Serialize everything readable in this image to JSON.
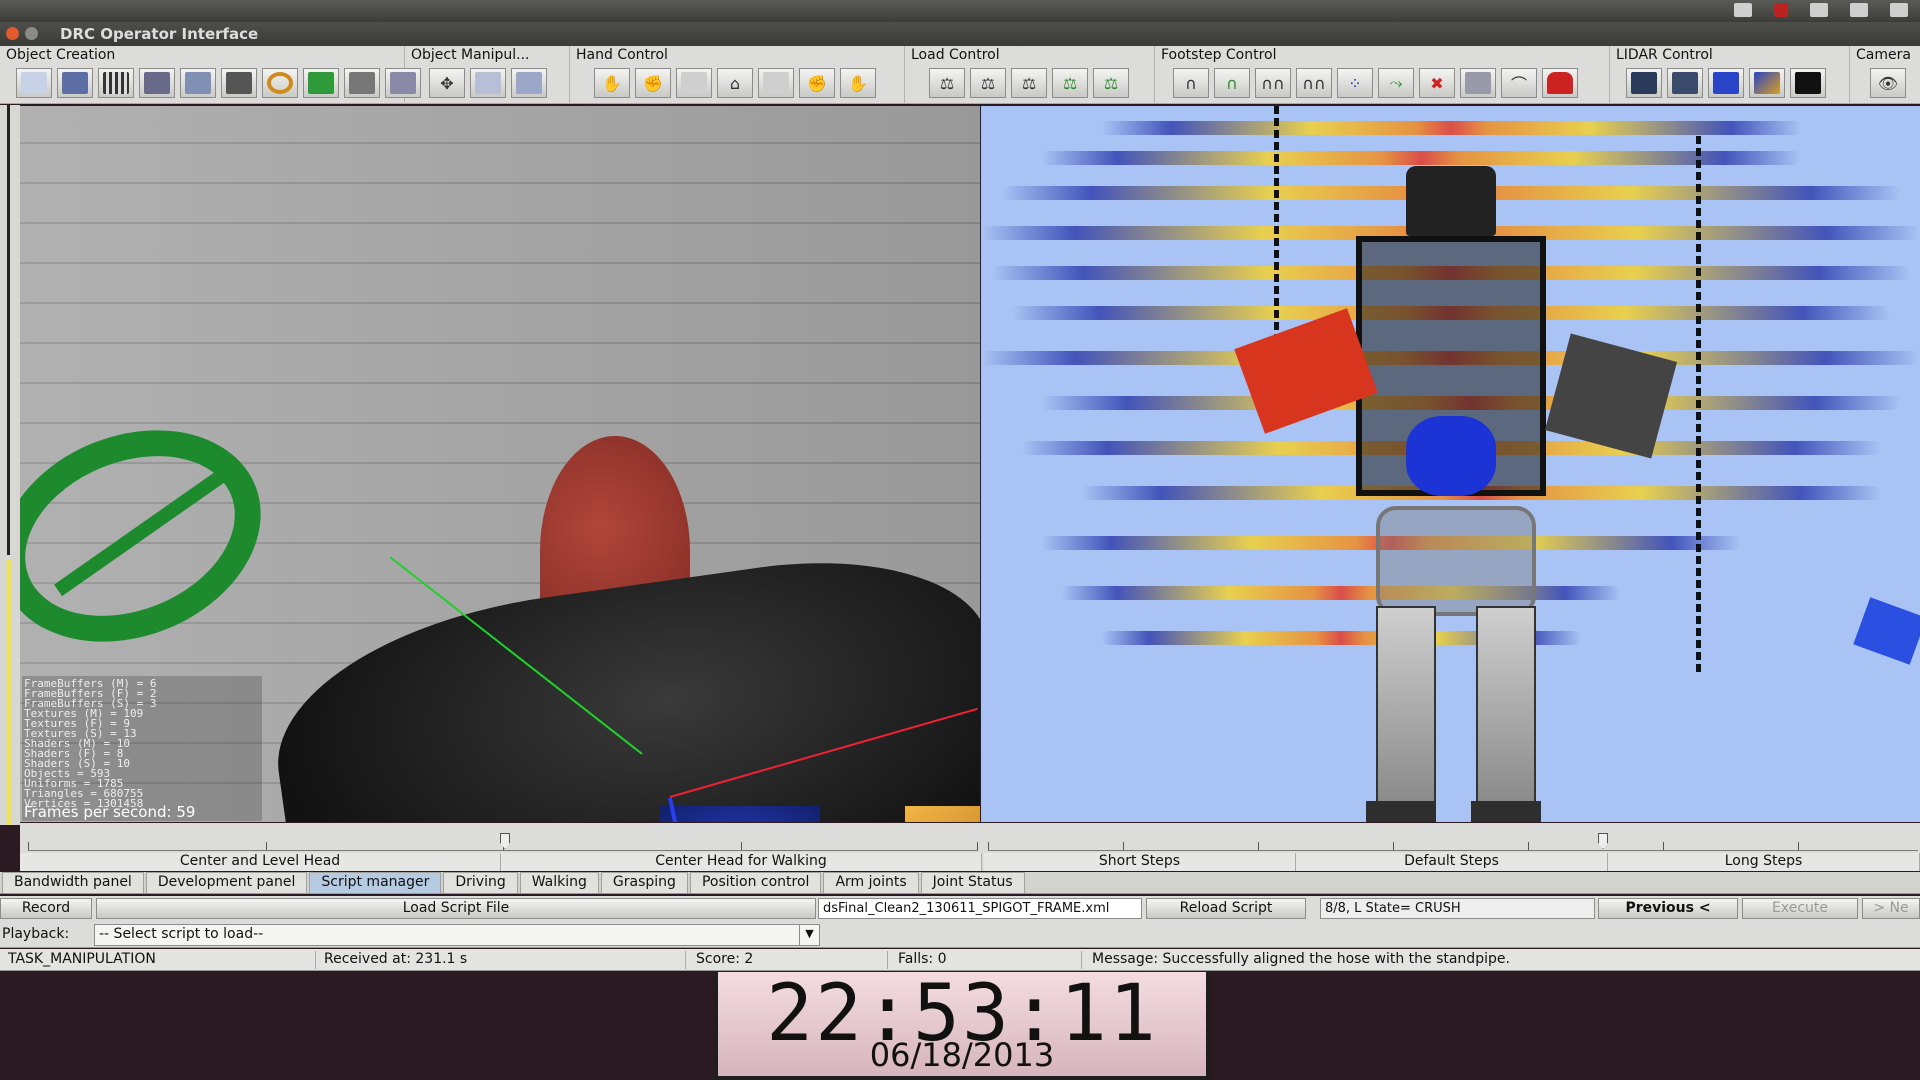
{
  "window": {
    "title": "DRC Operator Interface"
  },
  "toolbar": {
    "groups": [
      {
        "label": "Object Creation"
      },
      {
        "label": "Object Manipul..."
      },
      {
        "label": "Hand Control"
      },
      {
        "label": "Load Control"
      },
      {
        "label": "Footstep Control"
      },
      {
        "label": "LIDAR Control"
      },
      {
        "label": "Camera"
      }
    ]
  },
  "camera_view": {
    "stats": [
      "FrameBuffers (M) = 6",
      "FrameBuffers (F) = 2",
      "FrameBuffers (S) = 3",
      "Textures (M) = 109",
      "Textures (F) = 9",
      "Textures (S) = 13",
      "Shaders (M) = 10",
      "Shaders (F) = 8",
      "Shaders (S) = 10",
      "Objects = 593",
      "Uniforms = 1785",
      "Triangles = 680755",
      "Vertices = 1301458"
    ],
    "fps": "Frames per second: 59"
  },
  "sliders": {
    "left_labels": [
      "Center and Level Head",
      "Center Head for Walking"
    ],
    "right_labels": [
      "Short Steps",
      "Default Steps",
      "Long Steps"
    ]
  },
  "tabs": [
    "Bandwidth panel",
    "Development panel",
    "Script manager",
    "Driving",
    "Walking",
    "Grasping",
    "Position control",
    "Arm joints",
    "Joint Status"
  ],
  "script_manager": {
    "record_label": "Record",
    "load_label": "Load Script File",
    "file_name": "dsFinal_Clean2_130611_SPIGOT_FRAME.xml",
    "reload_label": "Reload Script",
    "state": "8/8, L State= CRUSH",
    "previous_label": "Previous <",
    "execute_label": "Execute",
    "next_label": "> Ne",
    "playback_label": "Playback:",
    "playback_select": "-- Select script to load--"
  },
  "status": {
    "task": "TASK_MANIPULATION",
    "received": "Received at:  231.1 s",
    "score": "Score:  2",
    "falls": "Falls:  0",
    "message": "Message:  Successfully aligned the hose with the standpipe."
  },
  "clock": {
    "time": "22:53:11",
    "date": "06/18/2013"
  }
}
